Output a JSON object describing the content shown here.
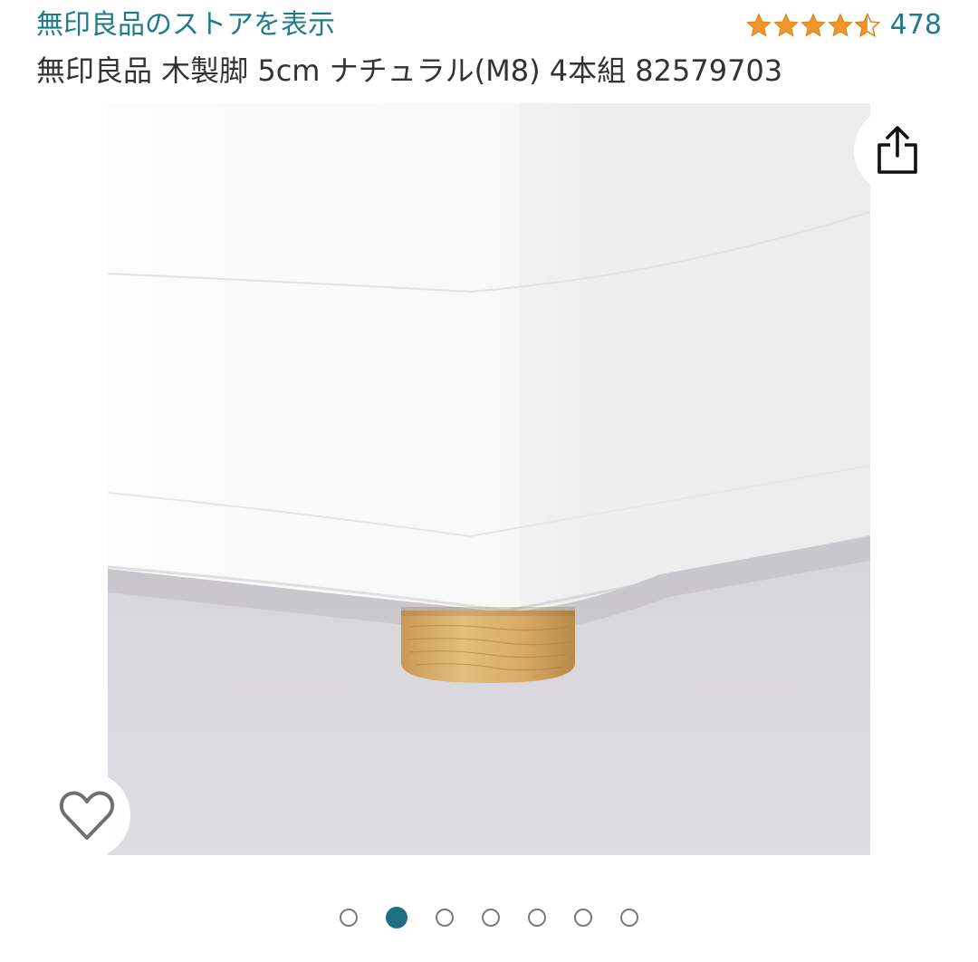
{
  "header": {
    "store_link": "無印良品のストアを表示",
    "rating": {
      "stars": 4.5,
      "count": "478",
      "star_color": "#f1962a"
    }
  },
  "product": {
    "title": "無印良品 木製脚 5cm ナチュラル(M8) 4本組 82579703"
  },
  "actions": {
    "share_icon": "share-icon",
    "favorite_icon": "heart-outline-icon"
  },
  "carousel": {
    "total": 7,
    "active_index": 1,
    "active_color": "#1f6f82"
  },
  "colors": {
    "link": "#1f7a8c",
    "text": "#333333"
  }
}
